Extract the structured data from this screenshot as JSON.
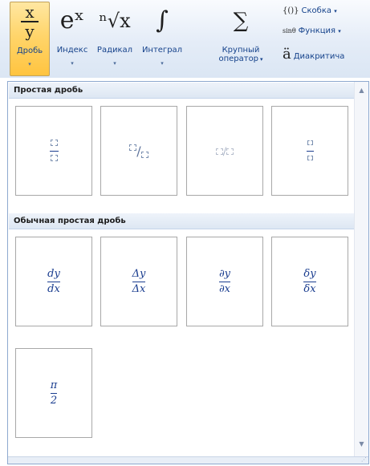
{
  "ribbon": {
    "buttons": [
      {
        "id": "fraction",
        "label": "Дробь",
        "label2": "",
        "num": "x",
        "den": "y"
      },
      {
        "id": "index",
        "label": "Индекс",
        "label2": "",
        "glyph": "eˣ"
      },
      {
        "id": "radical",
        "label": "Радикал",
        "label2": "",
        "glyph": "ⁿ√x"
      },
      {
        "id": "integral",
        "label": "Интеграл",
        "label2": "",
        "glyph": "∫"
      },
      {
        "id": "large_op",
        "label": "Крупный",
        "label2": "оператор",
        "glyph": "∑"
      }
    ],
    "small": [
      {
        "icon": "{()}",
        "label": "Скобка"
      },
      {
        "icon": "sinθ",
        "label": "Функция"
      },
      {
        "icon": "ä",
        "label": "Диакритича"
      }
    ],
    "dropdown_arrow": "▾"
  },
  "gallery": {
    "section1": "Простая дробь",
    "section2": "Обычная простая дробь",
    "common": [
      {
        "num": "dy",
        "den": "dx"
      },
      {
        "num": "Δy",
        "den": "Δx"
      },
      {
        "num": "∂y",
        "den": "∂x"
      },
      {
        "num": "δy",
        "den": "δx"
      },
      {
        "num": "π",
        "den": "2"
      }
    ],
    "slash": "/"
  }
}
